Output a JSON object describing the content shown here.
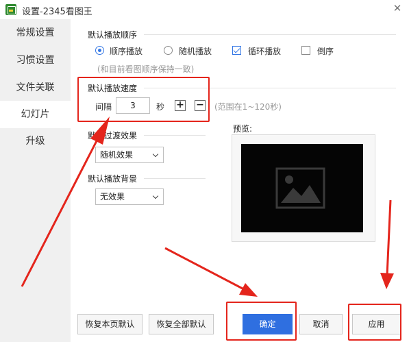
{
  "window": {
    "title": "设置-2345看图王",
    "close_icon": "close-icon"
  },
  "sidebar": {
    "items": [
      {
        "label": "常规设置",
        "active": false
      },
      {
        "label": "习惯设置",
        "active": false
      },
      {
        "label": "文件关联",
        "active": false
      },
      {
        "label": "幻灯片",
        "active": true
      },
      {
        "label": "升级",
        "active": false
      }
    ]
  },
  "order": {
    "title": "默认播放顺序",
    "options": [
      {
        "label": "顺序播放",
        "type": "radio",
        "checked": true
      },
      {
        "label": "随机播放",
        "type": "radio",
        "checked": false
      },
      {
        "label": "循环播放",
        "type": "checkbox",
        "checked": true
      },
      {
        "label": "倒序",
        "type": "checkbox",
        "checked": false
      }
    ],
    "hint": "(和目前看图顺序保持一致)"
  },
  "speed": {
    "title": "默认播放速度",
    "interval_label": "间隔",
    "value": "3",
    "unit": "秒",
    "plus": "+",
    "minus": "−",
    "range_hint": "(范围在1~120秒)"
  },
  "transition": {
    "title": "默认过渡效果",
    "selected": "随机效果"
  },
  "background": {
    "title": "默认播放背景",
    "selected": "无效果"
  },
  "preview": {
    "label": "预览:",
    "icon": "image-placeholder-icon"
  },
  "footer": {
    "restore_page": "恢复本页默认",
    "restore_all": "恢复全部默认",
    "ok": "确定",
    "cancel": "取消",
    "apply": "应用"
  },
  "colors": {
    "accent": "#2f6fe0",
    "annotation_red": "#e4251c",
    "sidebar_bg": "#f0f0f0",
    "preview_bg": "#050505"
  }
}
